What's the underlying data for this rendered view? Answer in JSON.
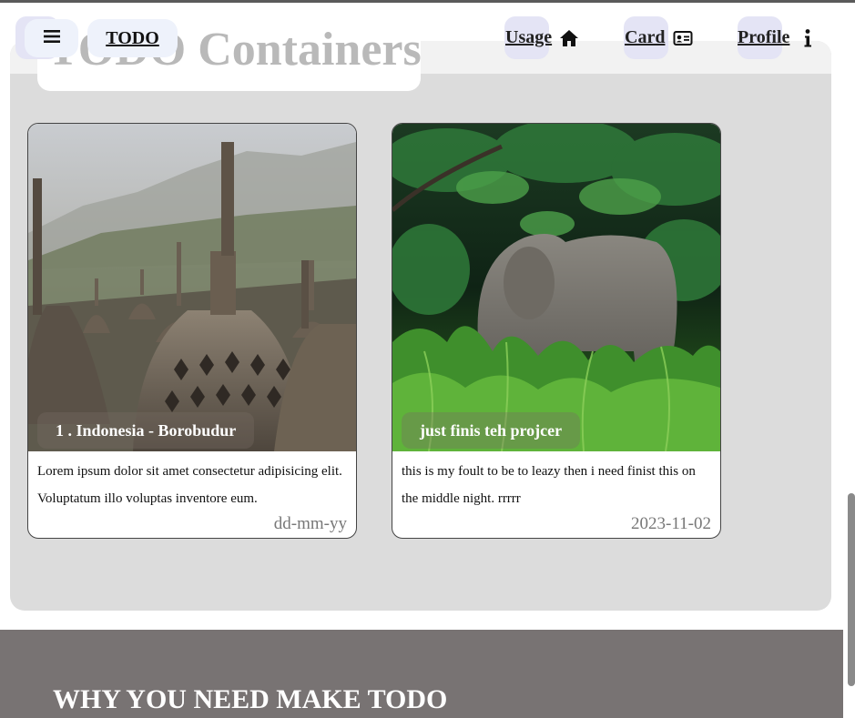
{
  "page": {
    "title": "TODO Containers"
  },
  "nav": {
    "menu_icon": "hamburger-icon",
    "brand_label": "TODO",
    "links": [
      {
        "label": "Usage",
        "icon": "home-icon"
      },
      {
        "label": "Card",
        "icon": "id-card-icon"
      },
      {
        "label": "Profile",
        "icon": "info-icon"
      }
    ]
  },
  "cards": [
    {
      "caption": "1 . Indonesia - Borobudur",
      "description": "Lorem ipsum dolor sit amet consectetur adipisicing elit. Voluptatum illo voluptas inventore eum.",
      "date": "dd-mm-yy",
      "image": "temple-stupas-photo"
    },
    {
      "caption": "just finis teh projcer",
      "description": "this is my foult to be to leazy then i need finist this on the middle night. rrrrr",
      "date": "2023-11-02",
      "image": "elephant-jungle-photo"
    }
  ],
  "footer": {
    "title": "WHY YOU NEED MAKE TODO"
  },
  "colors": {
    "panel": "#dcdcdc",
    "footer": "#787373",
    "nav_button": "#eef2fb"
  }
}
